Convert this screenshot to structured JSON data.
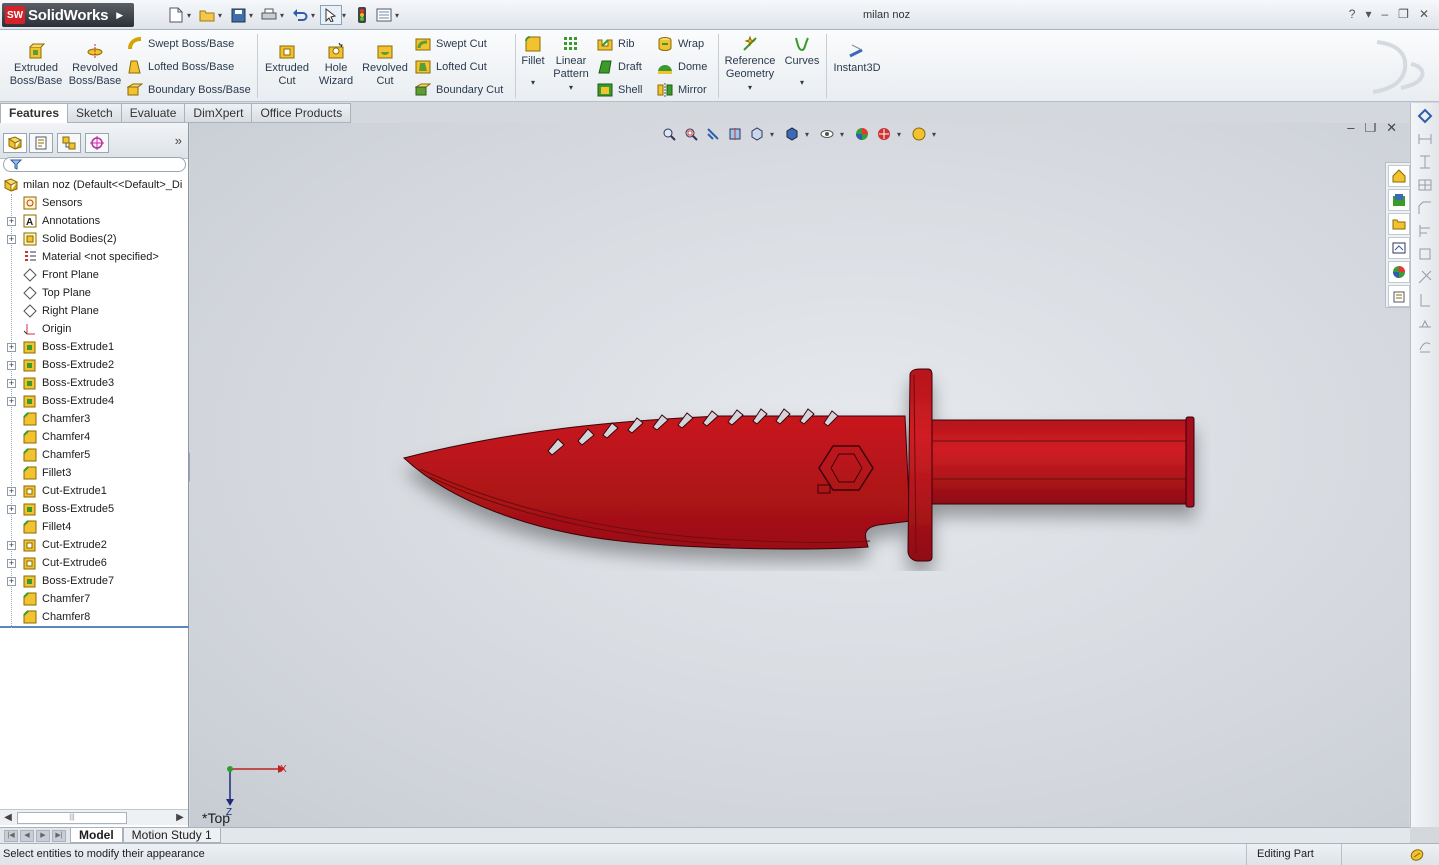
{
  "titlebar": {
    "brand_badge": "SW",
    "brand": "SolidWorks",
    "document_title": "milan noz",
    "help": "?"
  },
  "ribbon": {
    "extruded_boss": "Extruded\nBoss/Base",
    "revolved_boss": "Revolved\nBoss/Base",
    "swept_boss": "Swept Boss/Base",
    "lofted_boss": "Lofted Boss/Base",
    "boundary_boss": "Boundary Boss/Base",
    "extruded_cut": "Extruded\nCut",
    "hole_wizard": "Hole\nWizard",
    "revolved_cut": "Revolved\nCut",
    "swept_cut": "Swept Cut",
    "lofted_cut": "Lofted Cut",
    "boundary_cut": "Boundary Cut",
    "fillet": "Fillet",
    "linear_pattern": "Linear\nPattern",
    "rib": "Rib",
    "draft": "Draft",
    "shell": "Shell",
    "wrap": "Wrap",
    "dome": "Dome",
    "mirror": "Mirror",
    "reference_geometry": "Reference\nGeometry",
    "curves": "Curves",
    "instant3d": "Instant3D"
  },
  "command_tabs": [
    "Features",
    "Sketch",
    "Evaluate",
    "DimXpert",
    "Office Products"
  ],
  "tree": {
    "root": "milan noz  (Default<<Default>_Di",
    "items": [
      {
        "label": "Sensors",
        "expandable": false
      },
      {
        "label": "Annotations",
        "expandable": true
      },
      {
        "label": "Solid Bodies(2)",
        "expandable": true
      },
      {
        "label": "Material <not specified>",
        "expandable": false
      },
      {
        "label": "Front Plane",
        "expandable": false
      },
      {
        "label": "Top Plane",
        "expandable": false
      },
      {
        "label": "Right Plane",
        "expandable": false
      },
      {
        "label": "Origin",
        "expandable": false
      },
      {
        "label": "Boss-Extrude1",
        "expandable": true
      },
      {
        "label": "Boss-Extrude2",
        "expandable": true
      },
      {
        "label": "Boss-Extrude3",
        "expandable": true
      },
      {
        "label": "Boss-Extrude4",
        "expandable": true
      },
      {
        "label": "Chamfer3",
        "expandable": false
      },
      {
        "label": "Chamfer4",
        "expandable": false
      },
      {
        "label": "Chamfer5",
        "expandable": false
      },
      {
        "label": "Fillet3",
        "expandable": false
      },
      {
        "label": "Cut-Extrude1",
        "expandable": true
      },
      {
        "label": "Boss-Extrude5",
        "expandable": true
      },
      {
        "label": "Fillet4",
        "expandable": false
      },
      {
        "label": "Cut-Extrude2",
        "expandable": true
      },
      {
        "label": "Cut-Extrude6",
        "expandable": true
      },
      {
        "label": "Boss-Extrude7",
        "expandable": true
      },
      {
        "label": "Chamfer7",
        "expandable": false
      },
      {
        "label": "Chamfer8",
        "expandable": false
      }
    ]
  },
  "viewport": {
    "view_label": "*Top",
    "axis_x": "X",
    "axis_z": "Z",
    "model_color": "#b5141a"
  },
  "bottom_tabs": [
    "Model",
    "Motion Study 1"
  ],
  "status": {
    "message": "Select entities to modify their appearance",
    "mode": "Editing Part"
  }
}
